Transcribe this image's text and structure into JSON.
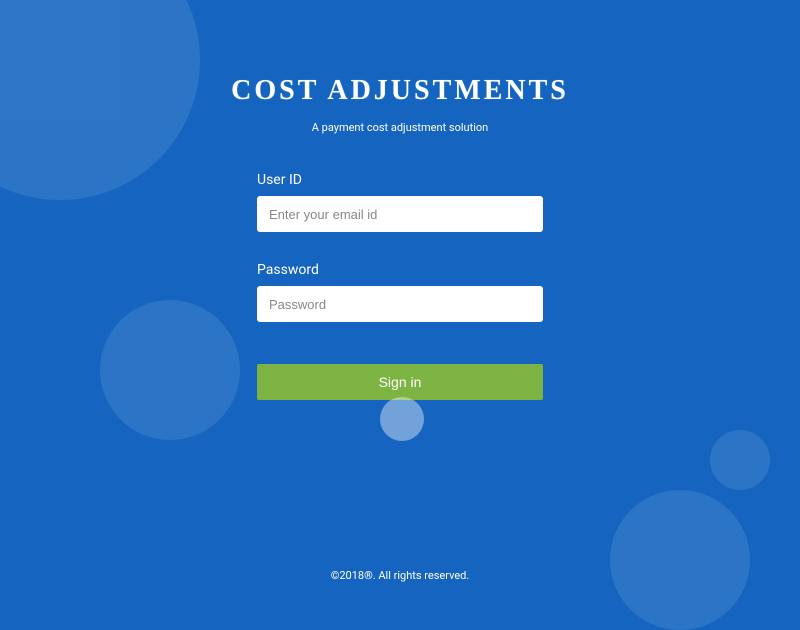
{
  "header": {
    "title": "COST ADJUSTMENTS",
    "subtitle": "A payment cost adjustment solution"
  },
  "form": {
    "userid": {
      "label": "User ID",
      "placeholder": "Enter your email id",
      "value": ""
    },
    "password": {
      "label": "Password",
      "placeholder": "Password",
      "value": ""
    },
    "submit_label": "Sign in"
  },
  "footer": {
    "copyright": "©2018®. All rights reserved."
  }
}
